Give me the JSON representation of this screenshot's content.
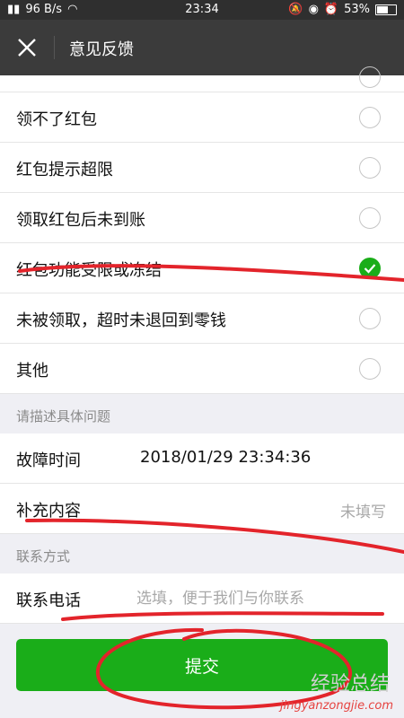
{
  "statusbar": {
    "network": "96 B/s",
    "time": "23:34",
    "battery": "53%",
    "battery_level": 0.53
  },
  "header": {
    "title": "意见反馈"
  },
  "options": [
    {
      "label": "领不了红包",
      "checked": false
    },
    {
      "label": "红包提示超限",
      "checked": false
    },
    {
      "label": "领取红包后未到账",
      "checked": false
    },
    {
      "label": "红包功能受限或冻结",
      "checked": true
    },
    {
      "label": "未被领取，超时未退回到零钱",
      "checked": false
    },
    {
      "label": "其他",
      "checked": false
    }
  ],
  "describe": {
    "section_label": "请描述具体问题",
    "fault_time_label": "故障时间",
    "fault_time_value": "2018/01/29 23:34:36",
    "supplement_label": "补充内容",
    "supplement_status": "未填写"
  },
  "contact": {
    "section_label": "联系方式",
    "phone_label": "联系电话",
    "phone_placeholder": "选填，便于我们与你联系"
  },
  "submit_label": "提交",
  "watermark": {
    "brand": "经验总结",
    "site": "jingyanzongjie.com"
  },
  "colors": {
    "accent": "#1aad19",
    "annotation": "#e3242b"
  }
}
